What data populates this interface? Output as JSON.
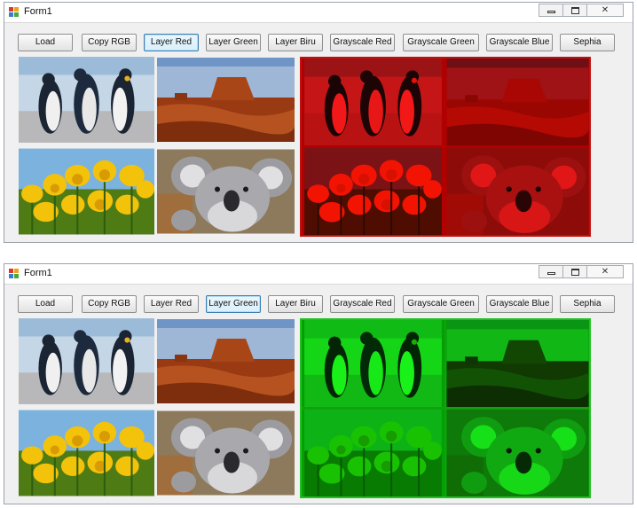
{
  "windows": [
    {
      "title": "Form1",
      "active_button": "layer_red",
      "filter_color": "#ff0000",
      "buttons": {
        "load": "Load",
        "copy_rgb": "Copy RGB",
        "layer_red": "Layer Red",
        "layer_green": "Layer Green",
        "layer_biru": "Layer Biru",
        "grayscale_red": "Grayscale Red",
        "grayscale_green": "Grayscale Green",
        "grayscale_blue": "Grayscale Blue",
        "sephia": "Sephia"
      },
      "images": [
        "penguins",
        "desert",
        "tulips",
        "koala"
      ]
    },
    {
      "title": "Form1",
      "active_button": "layer_green",
      "filter_color": "#00ff00",
      "buttons": {
        "load": "Load",
        "copy_rgb": "Copy RGB",
        "layer_red": "Layer Red",
        "layer_green": "Layer Green",
        "layer_biru": "Layer Biru",
        "grayscale_red": "Grayscale Red",
        "grayscale_green": "Grayscale Green",
        "grayscale_blue": "Grayscale Blue",
        "sephia": "Sephia"
      },
      "images": [
        "penguins",
        "desert",
        "tulips",
        "koala"
      ]
    }
  ],
  "icons": {
    "app": "winform-app-icon",
    "minimize": "minimize-icon",
    "maximize": "maximize-icon",
    "close": "close-icon"
  },
  "close_glyph": "✕"
}
